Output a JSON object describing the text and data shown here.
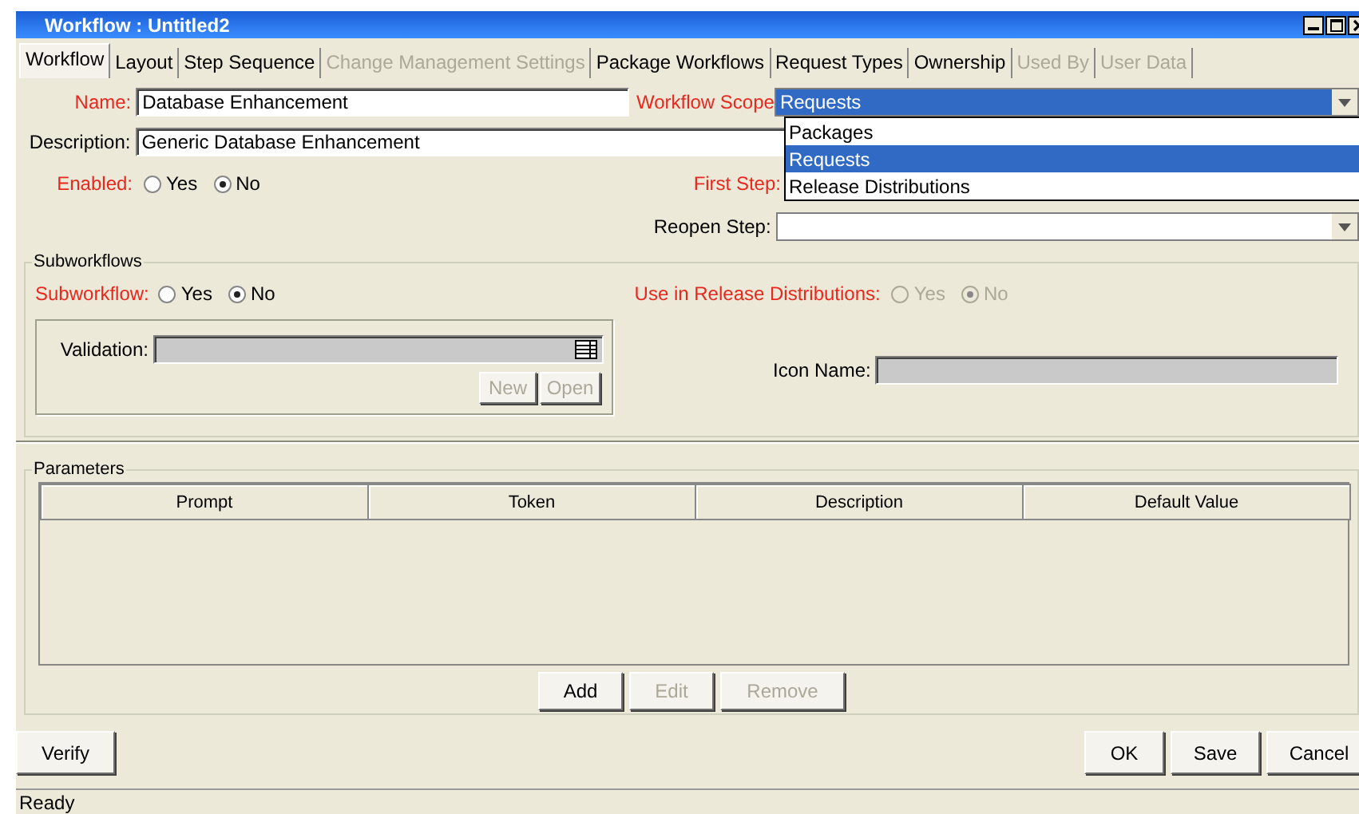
{
  "window": {
    "title": "Workflow : Untitled2"
  },
  "tabs": [
    {
      "label": "Workflow",
      "selected": true,
      "disabled": false
    },
    {
      "label": "Layout",
      "selected": false,
      "disabled": false
    },
    {
      "label": "Step Sequence",
      "selected": false,
      "disabled": false
    },
    {
      "label": "Change Management Settings",
      "selected": false,
      "disabled": true
    },
    {
      "label": "Package Workflows",
      "selected": false,
      "disabled": false
    },
    {
      "label": "Request Types",
      "selected": false,
      "disabled": false
    },
    {
      "label": "Ownership",
      "selected": false,
      "disabled": false
    },
    {
      "label": "Used By",
      "selected": false,
      "disabled": true
    },
    {
      "label": "User Data",
      "selected": false,
      "disabled": true
    }
  ],
  "general": {
    "name": {
      "label": "Name:",
      "value": "Database Enhancement",
      "required": true
    },
    "workflow_scope": {
      "label": "Workflow Scope",
      "value": "Requests",
      "required": true,
      "expanded": true,
      "options": [
        {
          "label": "Packages",
          "selected": false
        },
        {
          "label": "Requests",
          "selected": true
        },
        {
          "label": "Release Distributions",
          "selected": false
        }
      ]
    },
    "description": {
      "label": "Description:",
      "value": "Generic Database Enhancement",
      "required": false
    },
    "enabled": {
      "label": "Enabled:",
      "required": true,
      "options": [
        {
          "label": "Yes",
          "selected": false
        },
        {
          "label": "No",
          "selected": true
        }
      ]
    },
    "first_step": {
      "label": "First Step:",
      "required": true
    },
    "reopen_step": {
      "label": "Reopen Step:",
      "required": false
    }
  },
  "subworkflows": {
    "title": "Subworkflows",
    "subworkflow": {
      "label": "Subworkflow:",
      "required": true,
      "disabled": false,
      "options": [
        {
          "label": "Yes",
          "selected": false
        },
        {
          "label": "No",
          "selected": true
        }
      ]
    },
    "release_distributions": {
      "label": "Use in Release Distributions:",
      "required": true,
      "disabled": true,
      "options": [
        {
          "label": "Yes",
          "selected": false
        },
        {
          "label": "No",
          "selected": true
        }
      ]
    },
    "validation": {
      "label": "Validation:",
      "disabled": true
    },
    "buttons": [
      {
        "label": "New",
        "disabled": true
      },
      {
        "label": "Open",
        "disabled": true
      }
    ],
    "icon_name": {
      "label": "Icon Name:",
      "disabled": true
    }
  },
  "parameters": {
    "title": "Parameters",
    "columns": [
      "Prompt",
      "Token",
      "Description",
      "Default Value"
    ],
    "buttons": [
      {
        "label": "Add",
        "disabled": false
      },
      {
        "label": "Edit",
        "disabled": true
      },
      {
        "label": "Remove",
        "disabled": true
      }
    ]
  },
  "buttons_left": [
    {
      "label": "Verify",
      "disabled": false
    }
  ],
  "buttons_right": [
    {
      "label": "OK",
      "disabled": false
    },
    {
      "label": "Save",
      "disabled": false
    },
    {
      "label": "Cancel",
      "disabled": false
    }
  ],
  "status_bar": "Ready"
}
